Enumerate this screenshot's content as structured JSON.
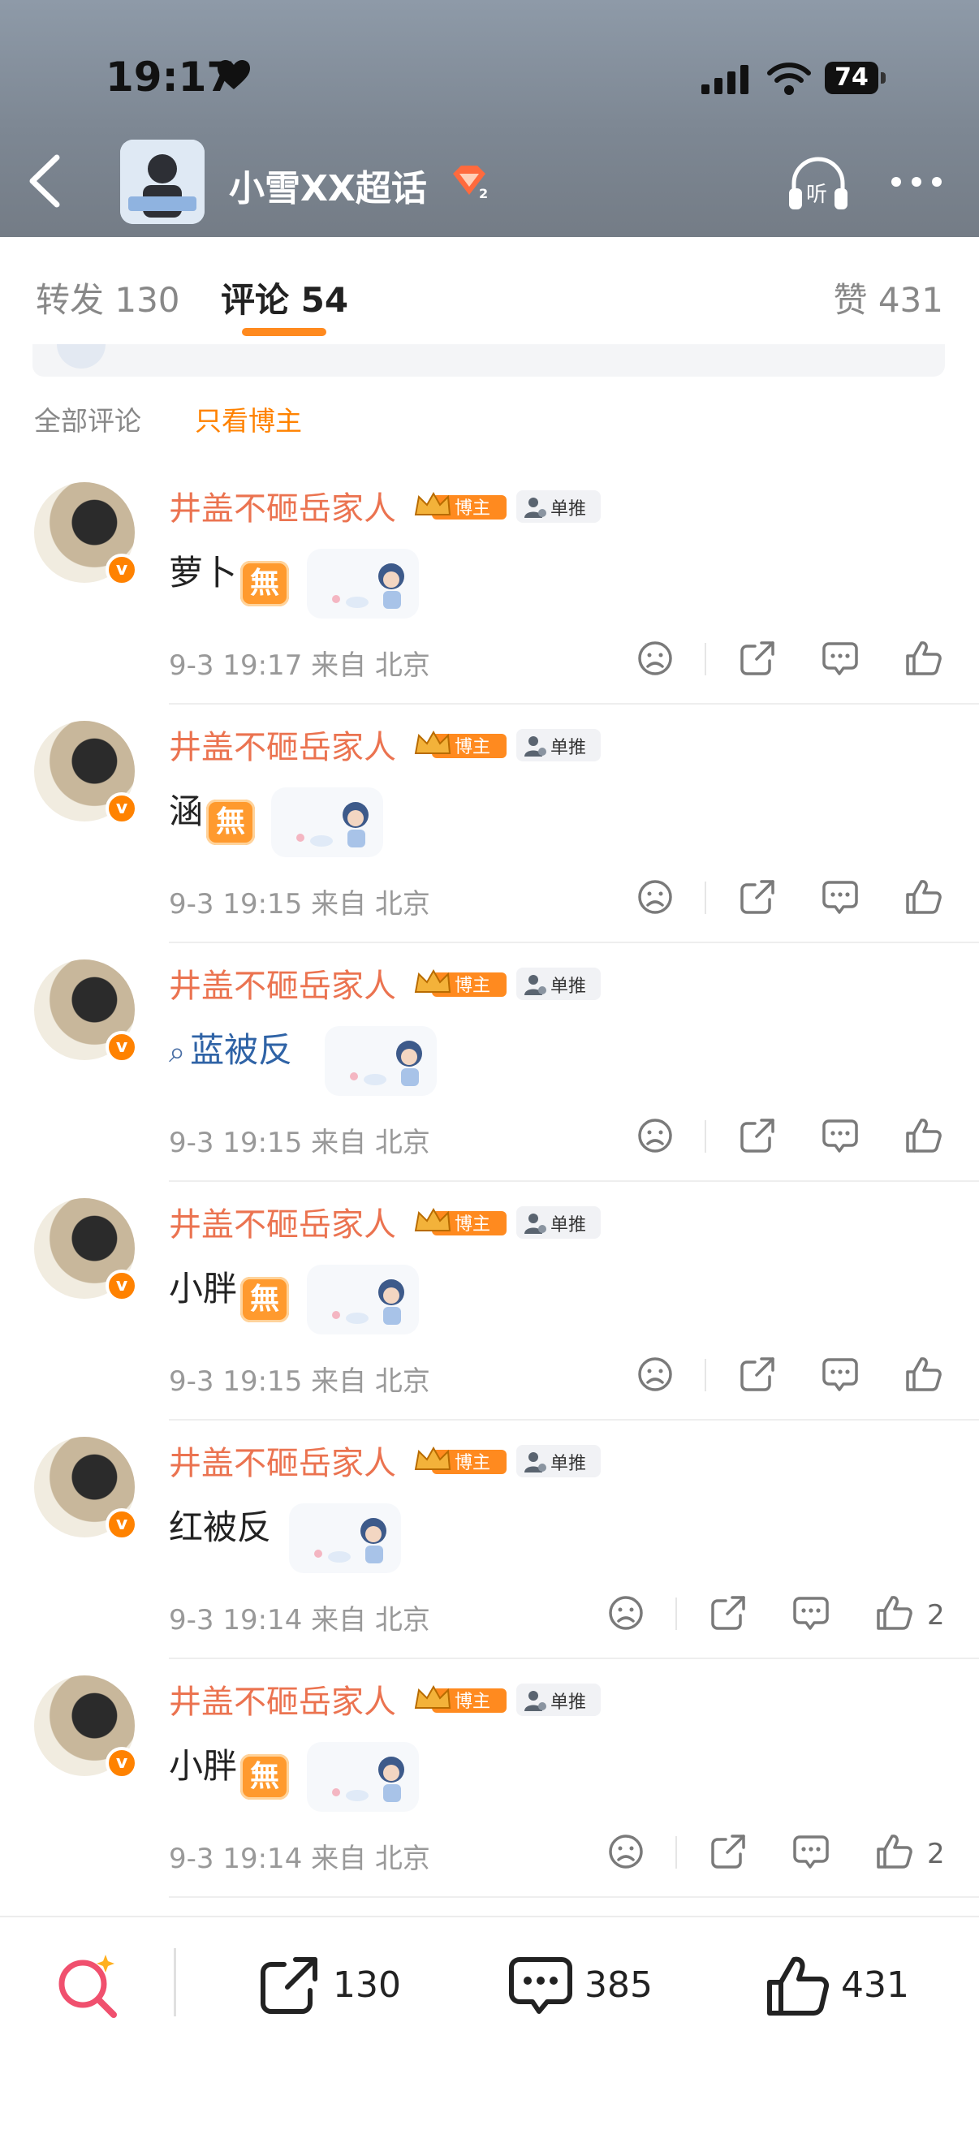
{
  "status_bar": {
    "time": "19:17",
    "battery": "74"
  },
  "header": {
    "title": "小雪XX超话",
    "level_badge": "2"
  },
  "tabs": {
    "repost": "转发 130",
    "comment": "评论 54",
    "like": "赞 431"
  },
  "filters": {
    "all": "全部评论",
    "blogger_only": "只看博主"
  },
  "comment_meta": {
    "username": "井盖不砸岳家人",
    "badge_label": "博主",
    "tag_label": "单推",
    "verified_mark": "v"
  },
  "comments": [
    {
      "text": "萝卜",
      "emoji": "無",
      "time": "9-3 19:17 来自 北京",
      "likes": ""
    },
    {
      "text": "涵",
      "emoji": "無",
      "time": "9-3 19:15 来自 北京",
      "likes": ""
    },
    {
      "text": "蓝被反",
      "is_search_link": true,
      "time": "9-3 19:15 来自 北京",
      "likes": ""
    },
    {
      "text": "小胖",
      "emoji": "無",
      "time": "9-3 19:15 来自 北京",
      "likes": ""
    },
    {
      "text": "红被反",
      "time": "9-3 19:14 来自 北京",
      "likes": "2"
    },
    {
      "text": "小胖",
      "emoji": "無",
      "time": "9-3 19:14 来自 北京",
      "likes": "2"
    }
  ],
  "bottom_bar": {
    "reposts": "130",
    "comments": "385",
    "likes": "431"
  },
  "colors": {
    "accent": "#ff8200",
    "username": "#eb7350"
  },
  "icons": [
    "back-icon",
    "listen-icon",
    "more-icon",
    "dislike-icon",
    "share-icon",
    "comment-icon",
    "thumb-up-icon",
    "search-icon"
  ]
}
